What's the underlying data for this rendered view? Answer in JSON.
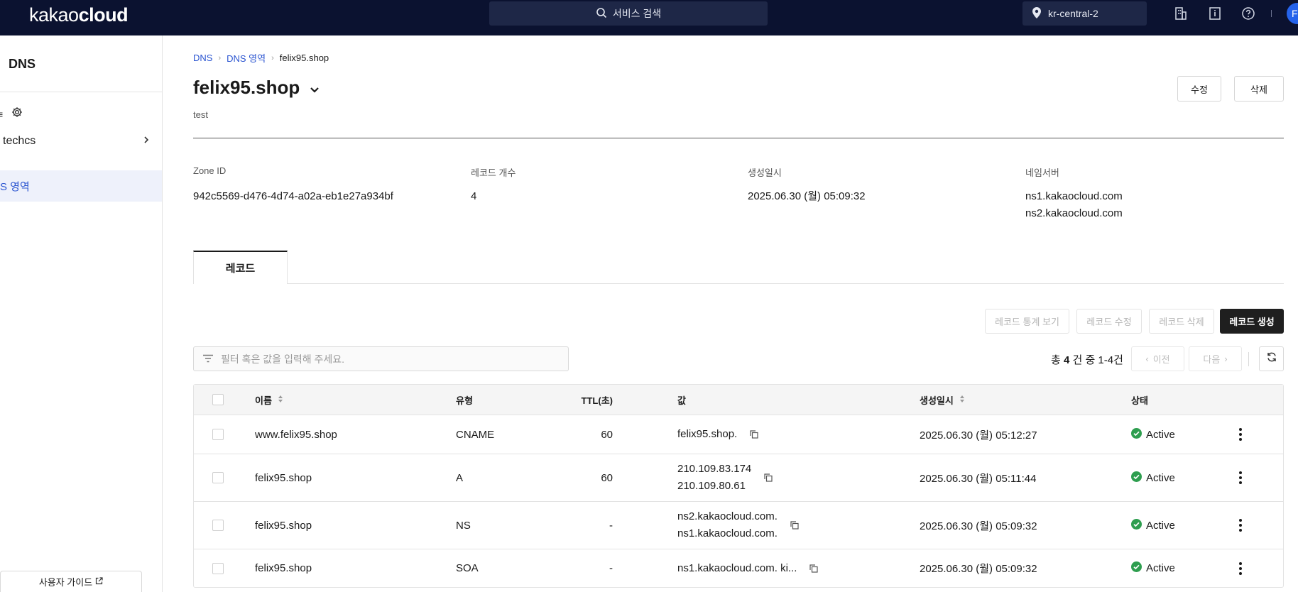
{
  "topbar": {
    "logo_light": "kakao",
    "logo_bold": "cloud",
    "search_label": "서비스 검색",
    "region": "kr-central-2",
    "avatar_initial": "F"
  },
  "sidebar": {
    "service_title": "DNS",
    "menu_icon_glyph": "≡",
    "project_label": "techcs",
    "active_item": "S 영역",
    "guide_label": "사용자 가이드"
  },
  "breadcrumb": {
    "level1": "DNS",
    "level2": "DNS 영역",
    "current": "felix95.shop"
  },
  "zone": {
    "name": "felix95.shop",
    "description": "test",
    "edit_label": "수정",
    "delete_label": "삭제"
  },
  "info": {
    "zone_id_label": "Zone ID",
    "zone_id": "942c5569-d476-4d74-a02a-eb1e27a934bf",
    "record_count_label": "레코드 개수",
    "record_count": "4",
    "created_label": "생성일시",
    "created": "2025.06.30 (월) 05:09:32",
    "nameserver_label": "네임서버",
    "nameserver_1": "ns1.kakaocloud.com",
    "nameserver_2": "ns2.kakaocloud.com"
  },
  "tabs": [
    {
      "label": "레코드",
      "selected": true
    }
  ],
  "actions": {
    "stats": "레코드 통계 보기",
    "edit": "레코드 수정",
    "delete": "레코드 삭제",
    "create": "레코드 생성"
  },
  "filter": {
    "placeholder": "필터 혹은 값을 입력해 주세요."
  },
  "pager": {
    "prefix": "총 ",
    "total": "4",
    "suffix": " 건 중 1-4건",
    "prev": "이전",
    "next": "다음"
  },
  "table": {
    "columns": {
      "name": "이름",
      "type": "유형",
      "ttl": "TTL(초)",
      "value": "값",
      "created": "생성일시",
      "status": "상태"
    },
    "rows": [
      {
        "name": "www.felix95.shop",
        "type": "CNAME",
        "ttl": "60",
        "value1": "felix95.shop.",
        "value2": "",
        "created": "2025.06.30 (월) 05:12:27",
        "status": "Active"
      },
      {
        "name": "felix95.shop",
        "type": "A",
        "ttl": "60",
        "value1": "210.109.83.174",
        "value2": "210.109.80.61",
        "created": "2025.06.30 (월) 05:11:44",
        "status": "Active"
      },
      {
        "name": "felix95.shop",
        "type": "NS",
        "ttl": "-",
        "value1": "ns2.kakaocloud.com.",
        "value2": "ns1.kakaocloud.com.",
        "created": "2025.06.30 (월) 05:09:32",
        "status": "Active"
      },
      {
        "name": "felix95.shop",
        "type": "SOA",
        "ttl": "-",
        "value1": "ns1.kakaocloud.com. ki...",
        "value2": "",
        "created": "2025.06.30 (월) 05:09:32",
        "status": "Active"
      }
    ]
  },
  "colors": {
    "topbar_bg": "#0b1230",
    "link": "#2b55d1",
    "active_green": "#2e9e4f",
    "primary_button": "#1f1f1f"
  }
}
